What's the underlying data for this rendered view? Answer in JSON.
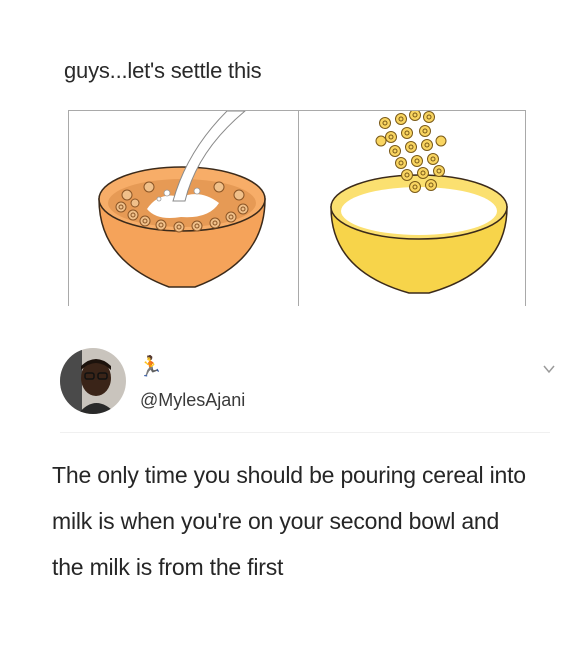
{
  "post": {
    "caption": "guys...let's settle this"
  },
  "illustration": {
    "left_panel_icon": "cereal-then-milk-bowl-icon",
    "right_panel_icon": "milk-then-cereal-bowl-icon",
    "colors": {
      "left_bowl": "#f5a35a",
      "right_bowl": "#f7d44a",
      "milk": "#ffffff",
      "cereal": "#e8a468"
    }
  },
  "tweet": {
    "handle": "@MylesAjani",
    "runner_icon": "runner-icon",
    "menu_icon": "chevron-down-icon",
    "text": "The only time you should be pouring cereal into milk is when you're on your second bowl and the milk is from the first"
  }
}
